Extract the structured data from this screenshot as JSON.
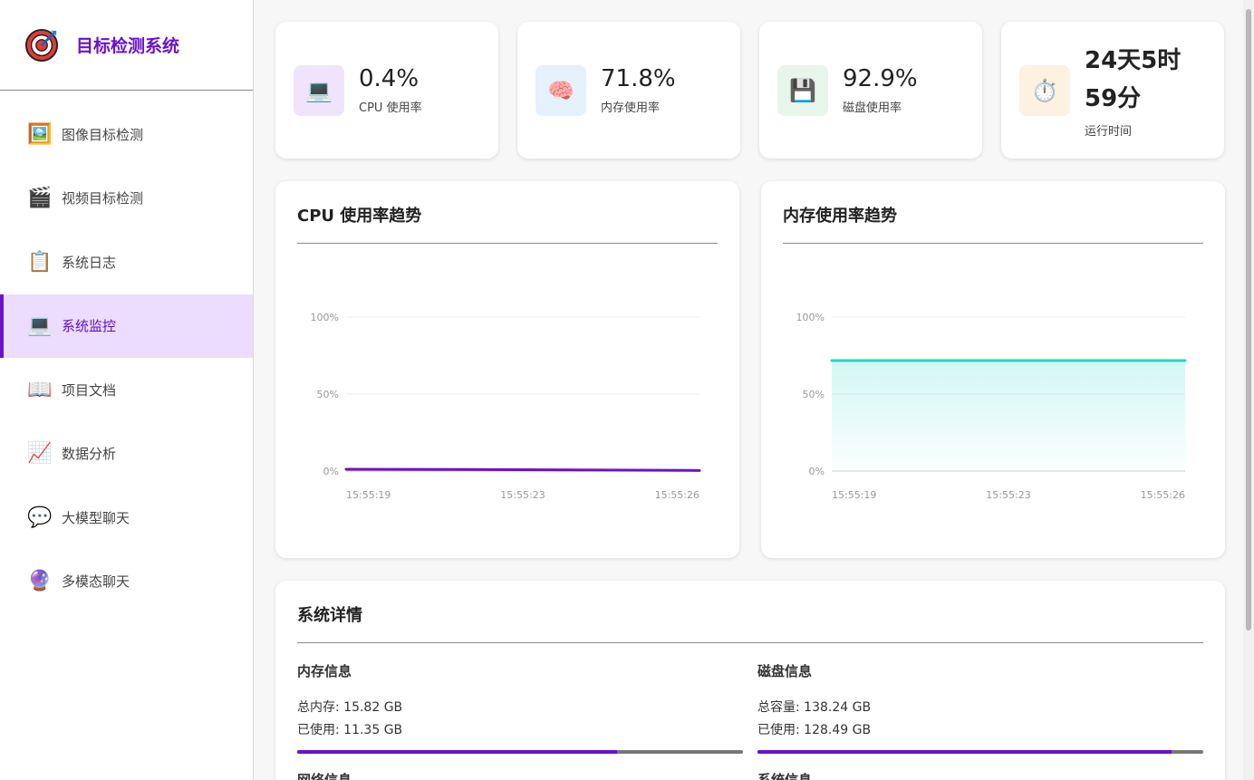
{
  "app": {
    "title": "目标检测系统"
  },
  "sidebar": {
    "items": [
      {
        "label": "图像目标检测",
        "icon": "picture-icon",
        "glyph": "🖼️"
      },
      {
        "label": "视频目标检测",
        "icon": "clapperboard-icon",
        "glyph": "🎬"
      },
      {
        "label": "系统日志",
        "icon": "clipboard-icon",
        "glyph": "📋"
      },
      {
        "label": "系统监控",
        "icon": "laptop-icon",
        "glyph": "💻",
        "active": true
      },
      {
        "label": "项目文档",
        "icon": "book-icon",
        "glyph": "📖"
      },
      {
        "label": "数据分析",
        "icon": "chart-icon",
        "glyph": "📈"
      },
      {
        "label": "大模型聊天",
        "icon": "speech-bubble-icon",
        "glyph": "💬"
      },
      {
        "label": "多模态聊天",
        "icon": "crystal-ball-icon",
        "glyph": "🔮"
      }
    ]
  },
  "stats": [
    {
      "value": "0.4%",
      "label": "CPU 使用率",
      "icon": "laptop-icon",
      "glyph": "💻",
      "bg": "#efe4fc"
    },
    {
      "value": "71.8%",
      "label": "内存使用率",
      "icon": "brain-icon",
      "glyph": "🧠",
      "bg": "#e5f1fc"
    },
    {
      "value": "92.9%",
      "label": "磁盘使用率",
      "icon": "floppy-disk-icon",
      "glyph": "💾",
      "bg": "#e8f5ea"
    },
    {
      "value": "24天5时59分",
      "label": "运行时间",
      "icon": "stopwatch-icon",
      "glyph": "⏱️",
      "bg": "#fdf1e2"
    }
  ],
  "charts": {
    "cpu": {
      "title": "CPU 使用率趋势"
    },
    "memory": {
      "title": "内存使用率趋势"
    }
  },
  "chart_data": [
    {
      "type": "line",
      "title": "CPU 使用率趋势",
      "x": [
        "15:55:19",
        "15:55:23",
        "15:55:26"
      ],
      "series": [
        {
          "values": [
            1.2,
            0.9,
            0.4
          ]
        }
      ],
      "yticks": [
        "0%",
        "50%",
        "100%"
      ],
      "ylim": [
        0,
        100
      ],
      "grid": true,
      "color": "#6a11cb"
    },
    {
      "type": "area",
      "title": "内存使用率趋势",
      "x": [
        "15:55:19",
        "15:55:23",
        "15:55:26"
      ],
      "series": [
        {
          "values": [
            71.8,
            71.8,
            71.8
          ]
        }
      ],
      "yticks": [
        "0%",
        "50%",
        "100%"
      ],
      "ylim": [
        0,
        100
      ],
      "grid": true,
      "color": "#1ed6c8"
    }
  ],
  "details": {
    "title": "系统详情",
    "memory": {
      "title": "内存信息",
      "total": "总内存: 15.82 GB",
      "used": "已使用: 11.35 GB",
      "fraction": 0.718
    },
    "disk": {
      "title": "磁盘信息",
      "total": "总容量: 138.24 GB",
      "used": "已使用: 128.49 GB",
      "fraction": 0.929
    },
    "network": {
      "title": "网络信息"
    },
    "system": {
      "title": "系统信息"
    }
  },
  "colors": {
    "accent": "#6a11cb",
    "active_bg": "#ecdcfd",
    "memory_line": "#1ed6c8"
  }
}
